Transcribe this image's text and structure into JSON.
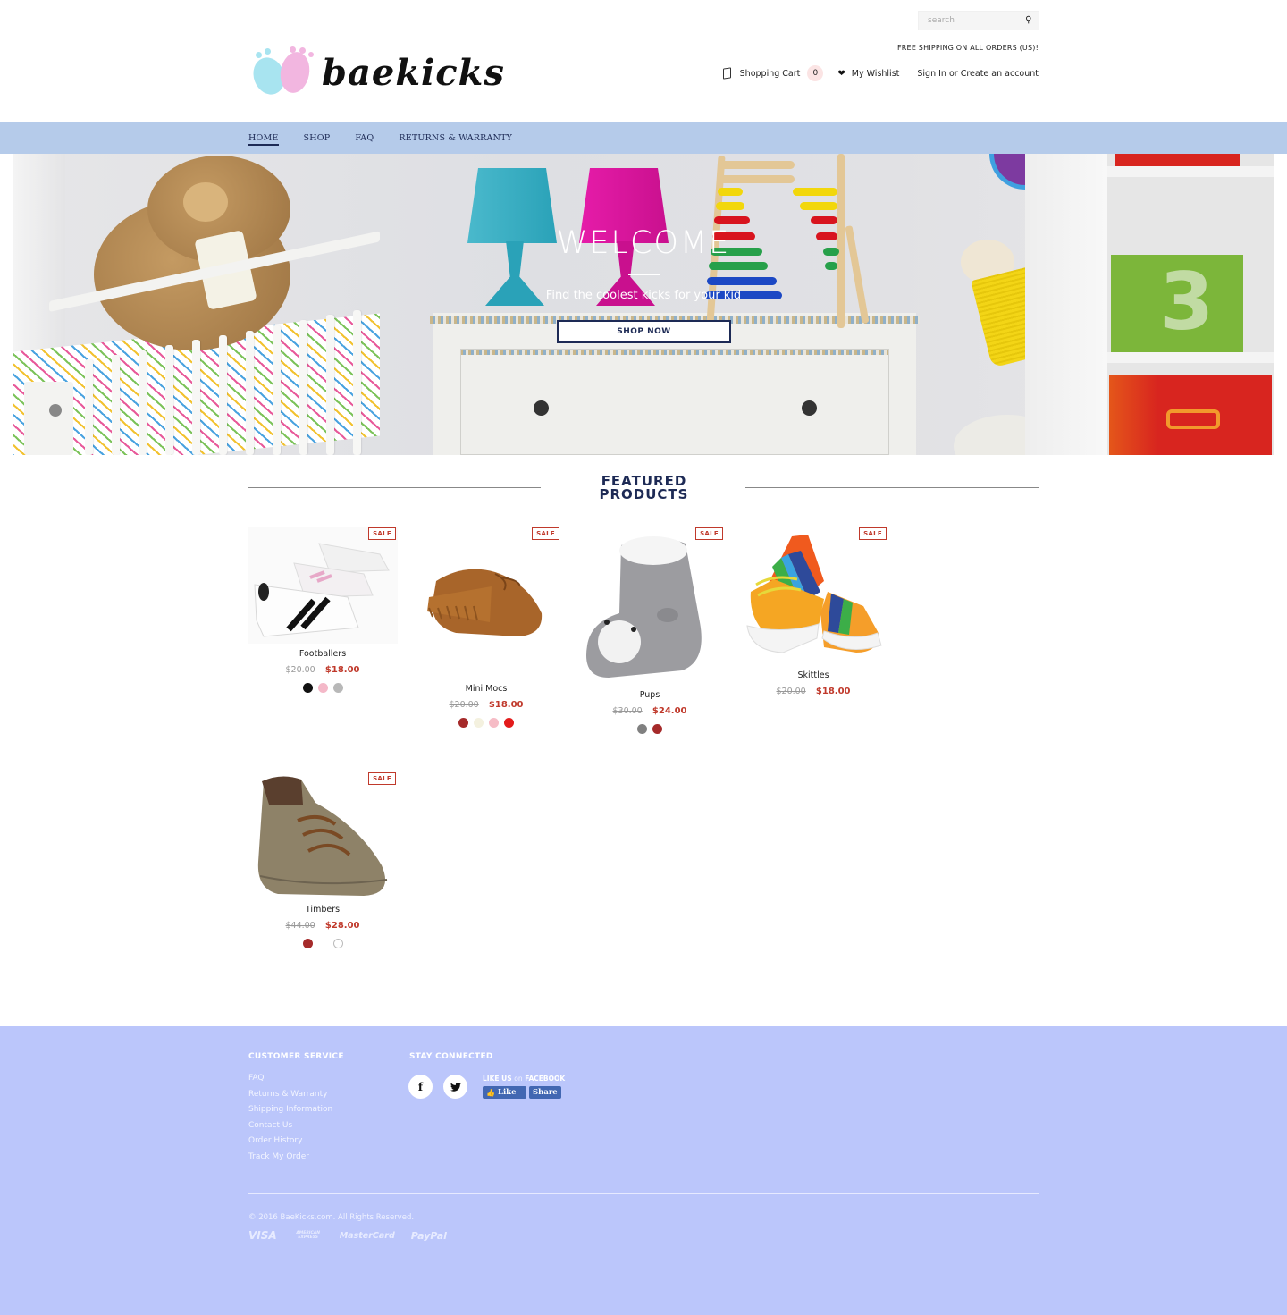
{
  "header": {
    "logo_text": "baekicks",
    "search_placeholder": "search",
    "free_shipping": "FREE SHIPPING ON ALL ORDERS (US)!",
    "cart_label": "Shopping Cart",
    "cart_count": "0",
    "wishlist_label": "My Wishlist",
    "account_label": "Sign In or Create an account"
  },
  "nav": {
    "items": [
      {
        "label": "HOME",
        "active": true
      },
      {
        "label": "SHOP"
      },
      {
        "label": "FAQ"
      },
      {
        "label": "RETURNS & WARRANTY"
      }
    ]
  },
  "hero": {
    "title": "WELCOME",
    "tagline": "Find the coolest kicks for your kid",
    "cta_label": "SHOP NOW"
  },
  "featured": {
    "title_line1": "FEATURED",
    "title_line2": "PRODUCTS",
    "sale_badge": "SALE",
    "products": [
      {
        "name": "Footballers",
        "old_price": "$20.00",
        "price": "$18.00",
        "swatches": [
          "#111111",
          "#f4b8c8",
          "#b8b8b8"
        ]
      },
      {
        "name": "Mini Mocs",
        "old_price": "$20.00",
        "price": "$18.00",
        "swatches": [
          "#a52a2a",
          "#f4f1df",
          "#f6bcc6",
          "#e31b1b"
        ]
      },
      {
        "name": "Pups",
        "old_price": "$30.00",
        "price": "$24.00",
        "swatches": [
          "#808080",
          "#a52a2a"
        ]
      },
      {
        "name": "Skittles",
        "old_price": "$20.00",
        "price": "$18.00",
        "swatches": []
      },
      {
        "name": "Timbers",
        "old_price": "$44.00",
        "price": "$28.00",
        "swatches": [
          "#a52a2a",
          "#ffffff"
        ]
      }
    ]
  },
  "footer": {
    "customer_service_heading": "CUSTOMER SERVICE",
    "customer_service_links": [
      "FAQ",
      "Returns & Warranty",
      "Shipping Information",
      "Contact Us",
      "Order History",
      "Track My Order"
    ],
    "stay_connected_heading": "STAY CONNECTED",
    "facebook_icon": "f",
    "twitter_icon": "❧",
    "like_us": "LIKE US",
    "like_us_on": "on",
    "like_us_facebook": "FACEBOOK",
    "fb_like": "Like",
    "fb_share": "Share",
    "copyright": "© 2016 BaeKicks.com. All Rights Reserved.",
    "payments": [
      "VISA",
      "AMERICAN EXPRESS",
      "MasterCard",
      "PayPal"
    ]
  },
  "colors": {
    "nav_bg": "#b5cbea",
    "footer_bg": "#bbc6fb",
    "brand_navy": "#1d2a55",
    "sale_red": "#c0392b"
  }
}
